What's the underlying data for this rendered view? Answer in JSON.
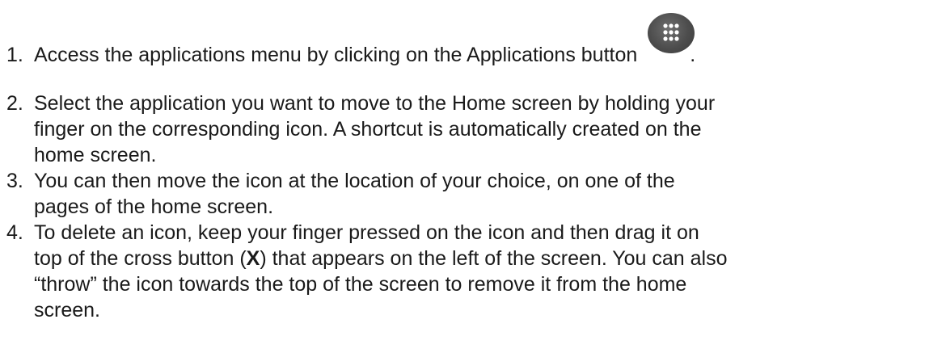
{
  "steps": [
    {
      "number": "1.",
      "lines": [
        "Access the applications menu by clicking on the Applications button"
      ],
      "after_icon": ".",
      "icon": "applications-grid-icon"
    },
    {
      "number": "2.",
      "lines": [
        "Select the application you want to move to the Home screen by holding your",
        "finger on the corresponding icon. A shortcut is automatically created on the",
        "home screen."
      ]
    },
    {
      "number": "3.",
      "lines": [
        "You can then move the icon at the location of your choice, on one of the",
        "pages of the home screen."
      ]
    },
    {
      "number": "4.",
      "lines": [
        "To delete an icon, keep your finger pressed on the icon and then drag it on",
        "top of the cross button (",
        "X",
        ") that appears on the left of the screen. You can also",
        "“throw” the icon towards the top of the screen to remove it from the home",
        "screen."
      ]
    }
  ]
}
